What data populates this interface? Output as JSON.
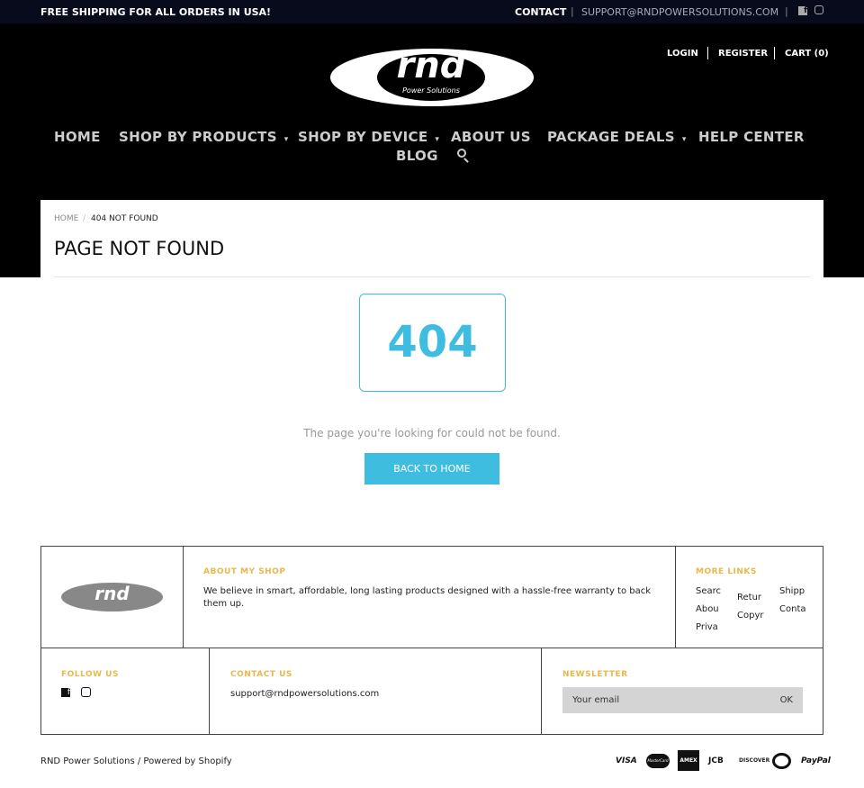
{
  "topbar": {
    "promo": "FREE SHIPPING FOR ALL ORDERS IN USA!",
    "contact": "CONTACT",
    "email": "SUPPORT@RNDPOWERSOLUTIONS.COM",
    "icons": [
      "facebook-icon",
      "instagram-icon"
    ]
  },
  "header": {
    "logo_text": "rnd",
    "logo_sub": "Power Solutions",
    "login": "LOGIN",
    "register": "REGISTER",
    "cart": "CART (0)"
  },
  "nav": {
    "items": [
      "HOME",
      "SHOP BY PRODUCTS",
      "SHOP BY DEVICE",
      "ABOUT US",
      "PACKAGE DEALS",
      "HELP CENTER",
      "BLOG"
    ],
    "caret": "▾"
  },
  "breadcrumb": {
    "home": "HOME",
    "sep": "/",
    "current": "404 NOT FOUND"
  },
  "page": {
    "title": "PAGE NOT FOUND",
    "code": "404",
    "message": "The page you're looking for could not be found.",
    "button": "BACK TO HOME"
  },
  "footer": {
    "about_title": "ABOUT MY SHOP",
    "about_text": "We believe in smart, affordable, long lasting products designed with a hassle-free warranty to back them up.",
    "more_title": "MORE LINKS",
    "more_links": [
      "Searc",
      "Abou",
      "Priva",
      "Retur",
      "Copyr",
      "Shipp",
      "Conta"
    ],
    "follow_title": "FOLLOW US",
    "contact_title": "CONTACT US",
    "contact_email": "support@rndpowersolutions.com",
    "newsletter_title": "NEWSLETTER",
    "email_placeholder": "Your email",
    "ok": "OK",
    "copyright": "RND Power Solutions / Powered by Shopify",
    "payments": [
      "VISA",
      "MasterCard",
      "AMEX",
      "JCB",
      "DISCOVER",
      "Diners",
      "PayPal"
    ]
  },
  "colors": {
    "accent": "#3fbde0",
    "footer_heading": "#e8b84a"
  }
}
